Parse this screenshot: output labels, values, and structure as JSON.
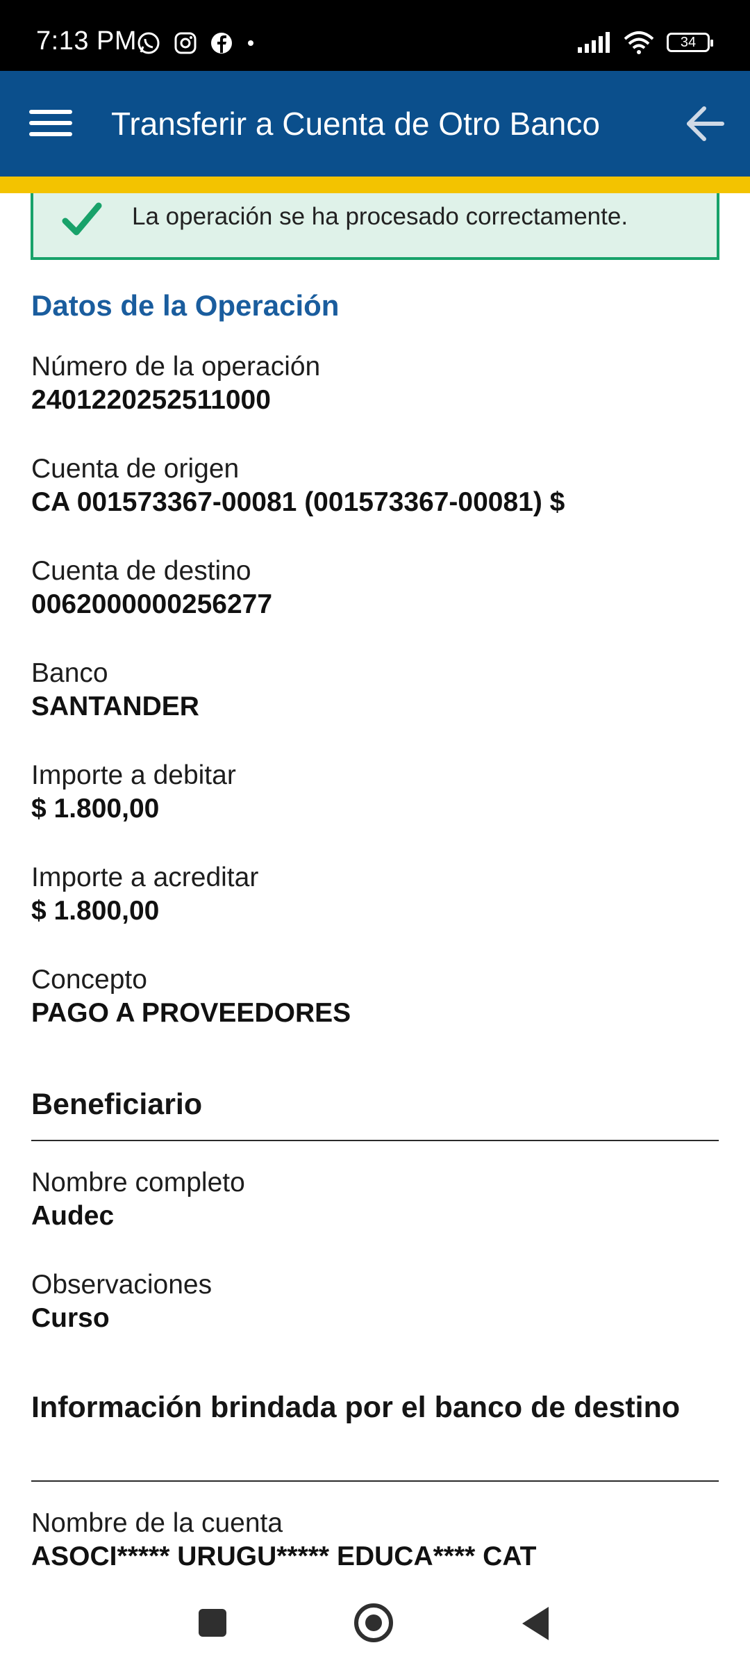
{
  "status_bar": {
    "time": "7:13 PM",
    "battery": "34",
    "left_icons": [
      "whatsapp-icon",
      "instagram-icon",
      "facebook-icon",
      "dot-icon"
    ],
    "right_icons": [
      "signal-icon",
      "wifi-icon",
      "battery-icon"
    ]
  },
  "header": {
    "title": "Transferir a Cuenta de Otro Banco",
    "menu_icon": "hamburger-menu-icon",
    "back_icon": "arrow-left-icon",
    "background_color": "#0b4f8c",
    "stripe_color": "#f3c300"
  },
  "success": {
    "message": "La operación se ha procesado correctamente.",
    "icon": "check-icon",
    "color": "#18a26a"
  },
  "operation": {
    "title": "Datos de la Operación",
    "fields": [
      {
        "label": "Número de la operación",
        "value": "2401220252511000"
      },
      {
        "label": "Cuenta de origen",
        "value": "CA 001573367-00081 (001573367-00081) $"
      },
      {
        "label": "Cuenta de destino",
        "value": "0062000000256277"
      },
      {
        "label": "Banco",
        "value": "SANTANDER"
      },
      {
        "label": "Importe a debitar",
        "value": "$ 1.800,00"
      },
      {
        "label": "Importe a acreditar",
        "value": "$ 1.800,00"
      },
      {
        "label": "Concepto",
        "value": "PAGO A PROVEEDORES"
      }
    ]
  },
  "beneficiary": {
    "title": "Beneficiario",
    "fields": [
      {
        "label": "Nombre completo",
        "value": "Audec"
      },
      {
        "label": "Observaciones",
        "value": "Curso"
      }
    ]
  },
  "bank_info": {
    "title": "Información brindada por el banco de destino",
    "fields": [
      {
        "label": "Nombre de la cuenta",
        "value": "ASOCI***** URUGU***** EDUCA**** CAT"
      }
    ]
  },
  "nav_bar": {
    "icons": [
      "recents-square-icon",
      "home-circle-icon",
      "back-triangle-icon"
    ]
  }
}
